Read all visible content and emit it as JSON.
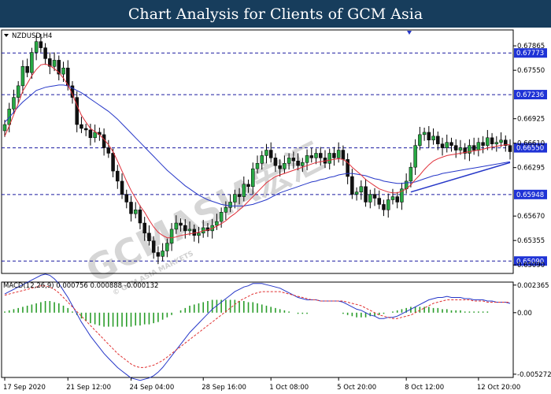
{
  "header": {
    "title": "Chart Analysis for Clients of GCM Asia"
  },
  "watermark": {
    "main": "GCMASIA宏汇",
    "sub": "© GCM ASIA MARKETS"
  },
  "colors": {
    "banner": "#173d5c",
    "candle_up": "#27a843",
    "candle_down": "#111111",
    "ma_fast": "#e0303a",
    "ma_slow": "#2637c8",
    "hline": "#1a1aa0",
    "label_bg": "#1f33d6",
    "macd_hist": "#2a9d2a",
    "macd_signal": "#e03030",
    "macd_line": "#2637c8"
  },
  "chart_data": [
    {
      "type": "candlestick",
      "title": "NZDUSD,H4",
      "ylim": [
        0.6493,
        0.6807
      ],
      "grid": false,
      "yticks": [
        "0.67865",
        "0.67550",
        "0.66925",
        "0.66610",
        "0.66295",
        "0.65670",
        "0.65355",
        "0.65090"
      ],
      "ytick_values": [
        0.67865,
        0.6755,
        0.66925,
        0.6661,
        0.66295,
        0.6567,
        0.65355,
        0.6504
      ],
      "levels": [
        {
          "label": "0.67773",
          "value": 0.67773
        },
        {
          "label": "0.67236",
          "value": 0.67236
        },
        {
          "label": "0.66550",
          "value": 0.6655
        },
        {
          "label": "0.65948",
          "value": 0.65948
        },
        {
          "label": "0.65090",
          "value": 0.6509
        }
      ],
      "xticks": [
        "17 Sep 2020",
        "21 Sep 12:00",
        "24 Sep 04:00",
        "28 Sep 16:00",
        "1 Oct 08:00",
        "5 Oct 20:00",
        "8 Oct 12:00",
        "12 Oct 20:00"
      ],
      "xtick_index": [
        0,
        14,
        28,
        44,
        59,
        74,
        89,
        105
      ],
      "closes": [
        0.6685,
        0.6705,
        0.672,
        0.6735,
        0.676,
        0.6752,
        0.6778,
        0.6792,
        0.6784,
        0.677,
        0.676,
        0.6768,
        0.675,
        0.6758,
        0.6735,
        0.672,
        0.6685,
        0.668,
        0.6678,
        0.6668,
        0.6675,
        0.6672,
        0.6655,
        0.6648,
        0.6625,
        0.6612,
        0.6595,
        0.6585,
        0.657,
        0.6575,
        0.6558,
        0.6545,
        0.6535,
        0.652,
        0.6515,
        0.6522,
        0.6532,
        0.655,
        0.6558,
        0.6555,
        0.6548,
        0.655,
        0.6542,
        0.6545,
        0.6552,
        0.6548,
        0.6555,
        0.656,
        0.6572,
        0.6578,
        0.6585,
        0.6595,
        0.6592,
        0.6608,
        0.6605,
        0.6628,
        0.6635,
        0.6645,
        0.6652,
        0.6642,
        0.6632,
        0.6628,
        0.6635,
        0.6642,
        0.6638,
        0.6632,
        0.6636,
        0.6645,
        0.6642,
        0.6648,
        0.6642,
        0.6635,
        0.6648,
        0.6642,
        0.6652,
        0.664,
        0.6618,
        0.6595,
        0.6598,
        0.6605,
        0.6585,
        0.6595,
        0.659,
        0.6582,
        0.6575,
        0.6588,
        0.6592,
        0.6585,
        0.6602,
        0.6612,
        0.663,
        0.6658,
        0.6672,
        0.6675,
        0.6665,
        0.667,
        0.666,
        0.6655,
        0.6662,
        0.6658,
        0.6652,
        0.6655,
        0.6648,
        0.6658,
        0.6652,
        0.6662,
        0.6658,
        0.6668,
        0.666,
        0.6662,
        0.6665,
        0.6658,
        0.665
      ],
      "series": [
        {
          "name": "ma_fast",
          "values": [
            0.667,
            0.6683,
            0.6698,
            0.6712,
            0.6728,
            0.6738,
            0.6748,
            0.6756,
            0.6762,
            0.6763,
            0.6761,
            0.6757,
            0.6752,
            0.6745,
            0.6736,
            0.6724,
            0.671,
            0.6697,
            0.6688,
            0.668,
            0.6676,
            0.6672,
            0.6666,
            0.6659,
            0.665,
            0.6638,
            0.6625,
            0.6612,
            0.66,
            0.659,
            0.658,
            0.6572,
            0.6562,
            0.6553,
            0.6546,
            0.6542,
            0.6539,
            0.6539,
            0.654,
            0.6542,
            0.6543,
            0.6544,
            0.6545,
            0.6546,
            0.6548,
            0.6549,
            0.6551,
            0.6554,
            0.6557,
            0.6561,
            0.6566,
            0.657,
            0.6575,
            0.658,
            0.6586,
            0.6592,
            0.6598,
            0.6604,
            0.661,
            0.6614,
            0.6618,
            0.662,
            0.6622,
            0.6624,
            0.6626,
            0.6628,
            0.663,
            0.6632,
            0.6634,
            0.6636,
            0.6637,
            0.6638,
            0.6639,
            0.664,
            0.6641,
            0.664,
            0.6636,
            0.663,
            0.6625,
            0.662,
            0.6614,
            0.661,
            0.6606,
            0.6602,
            0.66,
            0.6598,
            0.6597,
            0.6597,
            0.6599,
            0.6602,
            0.6607,
            0.6614,
            0.662,
            0.6627,
            0.6633,
            0.6638,
            0.6641,
            0.6643,
            0.6645,
            0.6646,
            0.6647,
            0.6648,
            0.6649,
            0.665,
            0.6651,
            0.6652,
            0.6653,
            0.6655,
            0.6656,
            0.6657,
            0.6658,
            0.6659,
            0.6659
          ]
        },
        {
          "name": "ma_slow",
          "values": [
            0.6688,
            0.6694,
            0.6701,
            0.6708,
            0.6714,
            0.6719,
            0.6724,
            0.6729,
            0.6731,
            0.6733,
            0.6734,
            0.6735,
            0.6736,
            0.6736,
            0.6735,
            0.6732,
            0.6729,
            0.6726,
            0.6722,
            0.6718,
            0.6714,
            0.671,
            0.6706,
            0.6702,
            0.6697,
            0.6692,
            0.6686,
            0.668,
            0.6674,
            0.6668,
            0.6662,
            0.6656,
            0.665,
            0.6644,
            0.6638,
            0.6632,
            0.6626,
            0.6621,
            0.6616,
            0.6611,
            0.6606,
            0.6602,
            0.6598,
            0.6594,
            0.6591,
            0.6588,
            0.6586,
            0.6584,
            0.6582,
            0.6581,
            0.658,
            0.658,
            0.658,
            0.658,
            0.6581,
            0.6582,
            0.6584,
            0.6586,
            0.6588,
            0.6591,
            0.6594,
            0.6597,
            0.6599,
            0.6601,
            0.6603,
            0.6605,
            0.6607,
            0.6609,
            0.6611,
            0.6612,
            0.6614,
            0.6615,
            0.6617,
            0.6618,
            0.662,
            0.6621,
            0.6622,
            0.6622,
            0.6621,
            0.662,
            0.6619,
            0.6617,
            0.6615,
            0.6614,
            0.6612,
            0.6611,
            0.661,
            0.6609,
            0.6609,
            0.661,
            0.661,
            0.6611,
            0.6613,
            0.6615,
            0.6617,
            0.6619,
            0.662,
            0.6622,
            0.6623,
            0.6624,
            0.6625,
            0.6626,
            0.6627,
            0.6628,
            0.6629,
            0.663,
            0.6631,
            0.6632,
            0.6633,
            0.6634,
            0.6635,
            0.6636,
            0.6637
          ]
        }
      ]
    },
    {
      "type": "macd",
      "title": "MACD(12,26,9) 0.000756 0.000888 -0.000132",
      "ylim": [
        -0.00555,
        0.00262
      ],
      "yticks": [
        "0.002365",
        "0.00",
        "-0.005272"
      ],
      "ytick_values": [
        0.002365,
        0,
        -0.005272
      ],
      "series": [
        {
          "name": "histogram",
          "values": [
            0.0001,
            0.0002,
            0.0003,
            0.0004,
            0.0005,
            0.0006,
            0.0007,
            0.0008,
            0.0009,
            0.001,
            0.001,
            0.0009,
            0.0008,
            0.0006,
            0.0004,
            0.0001,
            -0.0002,
            -0.0005,
            -0.0007,
            -0.0009,
            -0.001,
            -0.0011,
            -0.0012,
            -0.0012,
            -0.0012,
            -0.0012,
            -0.0012,
            -0.0012,
            -0.0012,
            -0.0011,
            -0.0011,
            -0.001,
            -0.001,
            -0.0009,
            -0.0008,
            -0.0006,
            -0.0004,
            -0.0002,
            0.0,
            0.0002,
            0.0004,
            0.0006,
            0.0007,
            0.0008,
            0.0009,
            0.001,
            0.0011,
            0.0011,
            0.0011,
            0.0011,
            0.0011,
            0.0011,
            0.001,
            0.001,
            0.0009,
            0.0009,
            0.0008,
            0.0007,
            0.0006,
            0.0005,
            0.0004,
            0.0003,
            0.0002,
            0.0001,
            0.0,
            -0.0001,
            -0.0001,
            -0.0001,
            0.0,
            0.0,
            0.0,
            0.0,
            0.0,
            0.0,
            0.0,
            -0.0001,
            -0.0002,
            -0.0003,
            -0.0004,
            -0.0004,
            -0.0004,
            -0.0003,
            -0.0003,
            -0.0002,
            -0.0001,
            0.0,
            0.0001,
            0.0002,
            0.0003,
            0.0004,
            0.0005,
            0.0005,
            0.0005,
            0.0005,
            0.0005,
            0.0004,
            0.0004,
            0.0003,
            0.0003,
            0.0002,
            0.0002,
            0.0002,
            0.0001,
            0.0001,
            0.0001,
            0.0001,
            0.0001,
            0.0001,
            0.0,
            0.0,
            0.0,
            0.0,
            0.0
          ]
        },
        {
          "name": "signal",
          "values": [
            0.0015,
            0.0016,
            0.0017,
            0.0018,
            0.0019,
            0.002,
            0.0021,
            0.0022,
            0.0023,
            0.0023,
            0.0022,
            0.002,
            0.0017,
            0.0013,
            0.0009,
            0.0005,
            0.0001,
            -0.0003,
            -0.0007,
            -0.0011,
            -0.0015,
            -0.0019,
            -0.0023,
            -0.0027,
            -0.0031,
            -0.0035,
            -0.0038,
            -0.0041,
            -0.0044,
            -0.0046,
            -0.0047,
            -0.0047,
            -0.0046,
            -0.0045,
            -0.0043,
            -0.0041,
            -0.0038,
            -0.0035,
            -0.0032,
            -0.0029,
            -0.0026,
            -0.0023,
            -0.002,
            -0.0017,
            -0.0014,
            -0.0011,
            -0.0008,
            -0.0005,
            -0.0002,
            0.0001,
            0.0004,
            0.0007,
            0.001,
            0.0012,
            0.0014,
            0.0016,
            0.0017,
            0.0018,
            0.0018,
            0.0018,
            0.0018,
            0.0018,
            0.0017,
            0.0016,
            0.0015,
            0.0014,
            0.0013,
            0.0012,
            0.0011,
            0.0011,
            0.001,
            0.001,
            0.001,
            0.001,
            0.001,
            0.001,
            0.0009,
            0.0008,
            0.0007,
            0.0006,
            0.0004,
            0.0002,
            0.0,
            -0.0002,
            -0.0003,
            -0.0004,
            -0.0005,
            -0.0005,
            -0.0004,
            -0.0003,
            -0.0002,
            0.0,
            0.0002,
            0.0004,
            0.0006,
            0.0008,
            0.0009,
            0.001,
            0.0011,
            0.0011,
            0.0011,
            0.0011,
            0.0011,
            0.0011,
            0.001,
            0.001,
            0.001,
            0.0009,
            0.0009,
            0.0009,
            0.0009,
            0.0009,
            0.0009
          ]
        },
        {
          "name": "macd",
          "values": [
            0.0016,
            0.0018,
            0.002,
            0.0022,
            0.0024,
            0.0026,
            0.0028,
            0.003,
            0.0032,
            0.0033,
            0.0032,
            0.0029,
            0.0025,
            0.0019,
            0.0013,
            0.0006,
            -0.0001,
            -0.0008,
            -0.0014,
            -0.002,
            -0.0025,
            -0.003,
            -0.0035,
            -0.0039,
            -0.0043,
            -0.0047,
            -0.005,
            -0.0053,
            -0.0056,
            -0.0057,
            -0.0058,
            -0.0057,
            -0.0056,
            -0.0054,
            -0.0051,
            -0.0047,
            -0.0042,
            -0.0037,
            -0.0032,
            -0.0027,
            -0.0022,
            -0.0017,
            -0.0013,
            -0.0009,
            -0.0005,
            -0.0001,
            0.0003,
            0.0006,
            0.0009,
            0.0012,
            0.0015,
            0.0018,
            0.002,
            0.0022,
            0.0023,
            0.0025,
            0.0025,
            0.0025,
            0.0024,
            0.0023,
            0.0022,
            0.0021,
            0.0019,
            0.0017,
            0.0015,
            0.0013,
            0.0012,
            0.0011,
            0.0011,
            0.0011,
            0.001,
            0.001,
            0.001,
            0.001,
            0.001,
            0.0009,
            0.0007,
            0.0005,
            0.0003,
            0.0002,
            0.0,
            -0.0002,
            -0.0003,
            -0.0005,
            -0.0005,
            -0.0004,
            -0.0004,
            -0.0003,
            -0.0001,
            0.0001,
            0.0003,
            0.0005,
            0.0007,
            0.0009,
            0.0011,
            0.0012,
            0.0013,
            0.0013,
            0.0014,
            0.0013,
            0.0013,
            0.0013,
            0.0012,
            0.0012,
            0.0011,
            0.0011,
            0.0011,
            0.001,
            0.001,
            0.0009,
            0.0009,
            0.0009,
            0.0008
          ]
        }
      ]
    }
  ]
}
